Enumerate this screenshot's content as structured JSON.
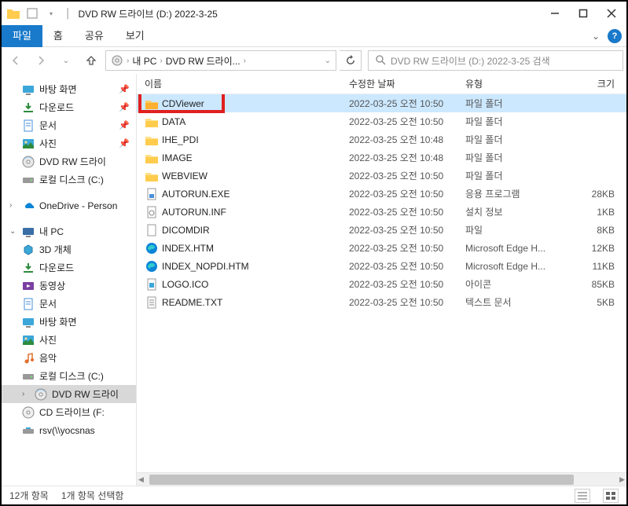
{
  "title": "DVD RW 드라이브 (D:) 2022-3-25",
  "ribbon": {
    "tabs": [
      "파일",
      "홈",
      "공유",
      "보기"
    ],
    "active": 0
  },
  "breadcrumb": {
    "pc": "내 PC",
    "drive": "DVD RW 드라이..."
  },
  "search": {
    "placeholder": "DVD RW 드라이브 (D:) 2022-3-25 검색"
  },
  "columns": {
    "name": "이름",
    "date": "수정한 날짜",
    "type": "유형",
    "size": "크기"
  },
  "sidebar": {
    "quick": [
      {
        "label": "바탕 화면",
        "icon": "desktop",
        "pin": true
      },
      {
        "label": "다운로드",
        "icon": "download",
        "pin": true
      },
      {
        "label": "문서",
        "icon": "document",
        "pin": true
      },
      {
        "label": "사진",
        "icon": "picture",
        "pin": true
      },
      {
        "label": "DVD RW 드라이",
        "icon": "dvd",
        "pin": false
      },
      {
        "label": "로컬 디스크 (C:)",
        "icon": "disk",
        "pin": false
      }
    ],
    "onedrive": "OneDrive - Person",
    "pc_label": "내 PC",
    "pc": [
      {
        "label": "3D 개체",
        "icon": "3d"
      },
      {
        "label": "다운로드",
        "icon": "download"
      },
      {
        "label": "동영상",
        "icon": "video"
      },
      {
        "label": "문서",
        "icon": "document"
      },
      {
        "label": "바탕 화면",
        "icon": "desktop"
      },
      {
        "label": "사진",
        "icon": "picture"
      },
      {
        "label": "음악",
        "icon": "music"
      },
      {
        "label": "로컬 디스크 (C:)",
        "icon": "disk"
      },
      {
        "label": "DVD RW 드라이",
        "icon": "dvd",
        "selected": true
      },
      {
        "label": "CD 드라이브 (F:",
        "icon": "cd"
      },
      {
        "label": "rsv(\\\\yocsnas",
        "icon": "netdrive"
      }
    ]
  },
  "files": [
    {
      "name": "CDViewer",
      "date": "2022-03-25 오전 10:50",
      "type": "파일 폴더",
      "size": "",
      "icon": "folder",
      "selected": true,
      "highlight": true
    },
    {
      "name": "DATA",
      "date": "2022-03-25 오전 10:50",
      "type": "파일 폴더",
      "size": "",
      "icon": "folder"
    },
    {
      "name": "IHE_PDI",
      "date": "2022-03-25 오전 10:48",
      "type": "파일 폴더",
      "size": "",
      "icon": "folder"
    },
    {
      "name": "IMAGE",
      "date": "2022-03-25 오전 10:48",
      "type": "파일 폴더",
      "size": "",
      "icon": "folder"
    },
    {
      "name": "WEBVIEW",
      "date": "2022-03-25 오전 10:50",
      "type": "파일 폴더",
      "size": "",
      "icon": "folder"
    },
    {
      "name": "AUTORUN.EXE",
      "date": "2022-03-25 오전 10:50",
      "type": "응용 프로그램",
      "size": "28KB",
      "icon": "exe"
    },
    {
      "name": "AUTORUN.INF",
      "date": "2022-03-25 오전 10:50",
      "type": "설치 정보",
      "size": "1KB",
      "icon": "inf"
    },
    {
      "name": "DICOMDIR",
      "date": "2022-03-25 오전 10:50",
      "type": "파일",
      "size": "8KB",
      "icon": "file"
    },
    {
      "name": "INDEX.HTM",
      "date": "2022-03-25 오전 10:50",
      "type": "Microsoft Edge H...",
      "size": "12KB",
      "icon": "edge"
    },
    {
      "name": "INDEX_NOPDI.HTM",
      "date": "2022-03-25 오전 10:50",
      "type": "Microsoft Edge H...",
      "size": "11KB",
      "icon": "edge"
    },
    {
      "name": "LOGO.ICO",
      "date": "2022-03-25 오전 10:50",
      "type": "아이콘",
      "size": "85KB",
      "icon": "ico"
    },
    {
      "name": "README.TXT",
      "date": "2022-03-25 오전 10:50",
      "type": "텍스트 문서",
      "size": "5KB",
      "icon": "txt"
    }
  ],
  "status": {
    "count": "12개 항목",
    "selection": "1개 항목 선택함"
  }
}
